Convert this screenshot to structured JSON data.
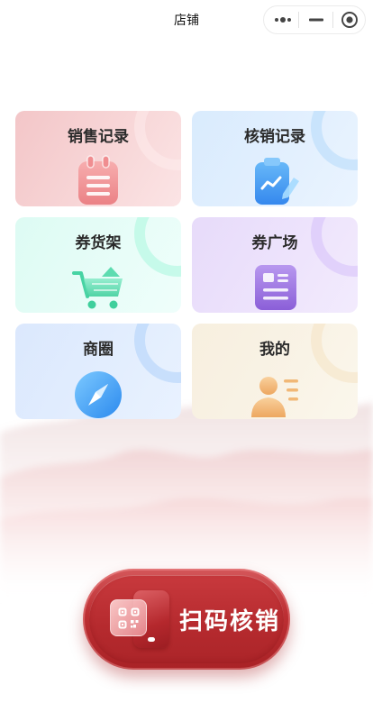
{
  "header": {
    "title": "店铺",
    "capsule": {
      "more_icon": "more-dots-icon",
      "minimize_icon": "minimize-icon",
      "close_icon": "target-icon"
    }
  },
  "menu": {
    "items": [
      {
        "label": "销售记录",
        "icon": "notepad-icon"
      },
      {
        "label": "核销记录",
        "icon": "clipboard-chart-icon"
      },
      {
        "label": "券货架",
        "icon": "shopping-cart-icon"
      },
      {
        "label": "券广场",
        "icon": "document-icon"
      },
      {
        "label": "商圈",
        "icon": "compass-icon"
      },
      {
        "label": "我的",
        "icon": "user-card-icon"
      }
    ]
  },
  "scan_button": {
    "label": "扫码核销",
    "icon": "qr-code-icon"
  },
  "colors": {
    "scan_red": "#bd2f33",
    "card_pink": "#f3c6c8",
    "card_blue": "#d9ebfd",
    "card_mint": "#ddfbf3",
    "card_lavender": "#e7dbfa",
    "card_cream": "#f7efdf"
  }
}
